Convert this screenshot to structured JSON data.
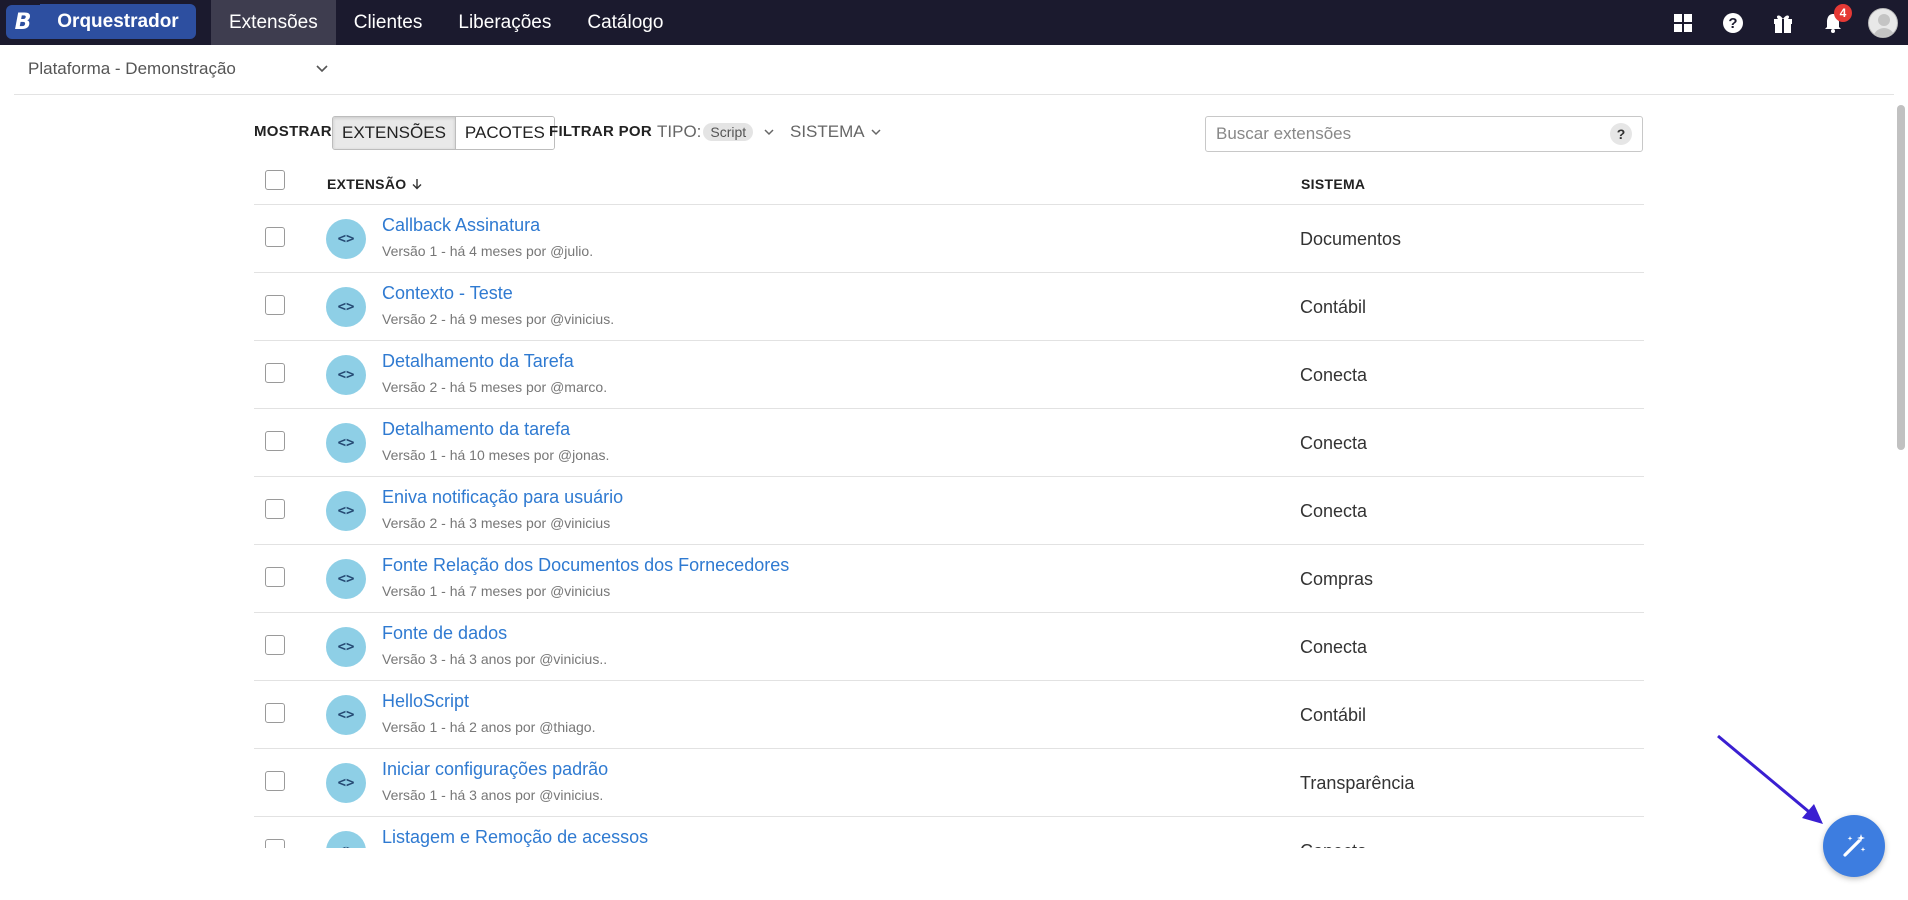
{
  "brand": {
    "logo_letter": "B",
    "name": "Orquestrador"
  },
  "nav": {
    "tabs": [
      "Extensões",
      "Clientes",
      "Liberações",
      "Catálogo"
    ],
    "active_tab": "Extensões"
  },
  "header_icons": {
    "notifications_count": "4"
  },
  "context": {
    "selected": "Plataforma - Demonstração"
  },
  "toolbar": {
    "show_label": "MOSTRAR",
    "show_options": [
      "EXTENSÕES",
      "PACOTES"
    ],
    "filter_label": "FILTRAR POR",
    "type_label": "TIPO:",
    "type_value": "Script",
    "system_label": "SISTEMA",
    "search_placeholder": "Buscar extensões",
    "help": "?"
  },
  "table": {
    "col_extension": "EXTENSÃO",
    "col_system": "SISTEMA",
    "rows": [
      {
        "name": "Callback Assinatura",
        "meta": "Versão 1 - há 4 meses por @julio.",
        "system": "Documentos"
      },
      {
        "name": "Contexto - Teste",
        "meta": "Versão 2 - há 9 meses por @vinicius.",
        "system": "Contábil"
      },
      {
        "name": "Detalhamento da Tarefa",
        "meta": "Versão 2 - há 5 meses por @marco.",
        "system": "Conecta"
      },
      {
        "name": "Detalhamento da tarefa",
        "meta": "Versão 1 - há 10 meses por @jonas.",
        "system": "Conecta"
      },
      {
        "name": "Eniva notificação para usuário",
        "meta": "Versão 2 - há 3 meses por @vinicius",
        "system": "Conecta"
      },
      {
        "name": "Fonte Relação dos Documentos dos Fornecedores",
        "meta": "Versão 1 - há 7 meses por @vinicius",
        "system": "Compras"
      },
      {
        "name": "Fonte de dados",
        "meta": "Versão 3 - há 3 anos por @vinicius..",
        "system": "Conecta"
      },
      {
        "name": "HelloScript",
        "meta": "Versão 1 - há 2 anos por @thiago.",
        "system": "Contábil"
      },
      {
        "name": "Iniciar configurações padrão",
        "meta": "Versão 1 - há 3 anos por @vinicius.",
        "system": "Transparência"
      },
      {
        "name": "Listagem e Remoção de acessos",
        "meta": "",
        "system": "Conecta"
      }
    ]
  },
  "colors": {
    "topbar": "#1b1a2e",
    "brand": "#2d4fa0",
    "link": "#2f7ad1",
    "icon_bg": "#8ecfe6",
    "fab": "#3d7de0",
    "arrow": "#3a1fd1"
  },
  "icons": [
    "apps-grid-icon",
    "help-icon",
    "gift-icon",
    "bell-icon",
    "avatar",
    "code-icon",
    "magic-wand-icon",
    "arrow-pointer"
  ]
}
